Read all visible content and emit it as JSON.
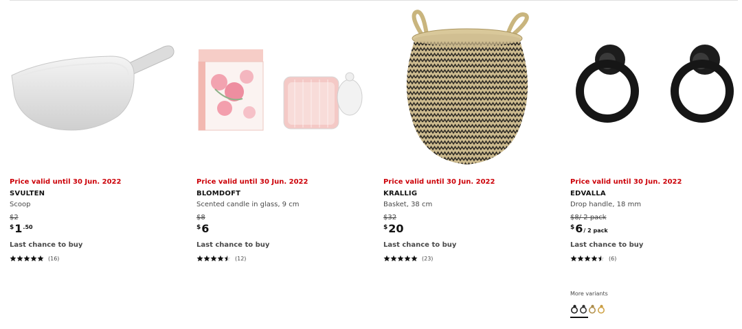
{
  "products": [
    {
      "validity": "Price valid until 30 Jun. 2022",
      "name": "SVULTEN",
      "description": "Scoop",
      "old_price": "$2",
      "price_currency": "$",
      "price_integer": "1",
      "price_decimal": ".50",
      "price_unit": "",
      "status": "Last chance to buy",
      "rating": 5,
      "review_count": "(16)",
      "image": "white-plastic-scoop"
    },
    {
      "validity": "Price valid until 30 Jun. 2022",
      "name": "BLOMDOFT",
      "description": "Scented candle in glass, 9 cm",
      "old_price": "$8",
      "price_currency": "$",
      "price_integer": "6",
      "price_decimal": "",
      "price_unit": "",
      "status": "Last chance to buy",
      "rating": 4.5,
      "review_count": "(12)",
      "image": "pink-candle-and-box"
    },
    {
      "validity": "Price valid until 30 Jun. 2022",
      "name": "KRALLIG",
      "description": "Basket, 38 cm",
      "old_price": "$32",
      "price_currency": "$",
      "price_integer": "20",
      "price_decimal": "",
      "price_unit": "",
      "status": "Last chance to buy",
      "rating": 5,
      "review_count": "(23)",
      "image": "woven-seagrass-basket"
    },
    {
      "validity": "Price valid until 30 Jun. 2022",
      "name": "EDVALLA",
      "description": "Drop handle, 18 mm",
      "old_price": "$8/ 2 pack",
      "price_currency": "$",
      "price_integer": "6",
      "price_decimal": "",
      "price_unit": "/ 2 pack",
      "status": "Last chance to buy",
      "rating": 4.5,
      "review_count": "(6)",
      "image": "black-ring-drop-handles",
      "more_variants_label": "More variants",
      "variants": [
        "black",
        "black-dark",
        "brass",
        "gold"
      ]
    }
  ],
  "colors": {
    "validity_red": "#cc0008",
    "text_dark": "#111111",
    "text_muted": "#484848"
  }
}
